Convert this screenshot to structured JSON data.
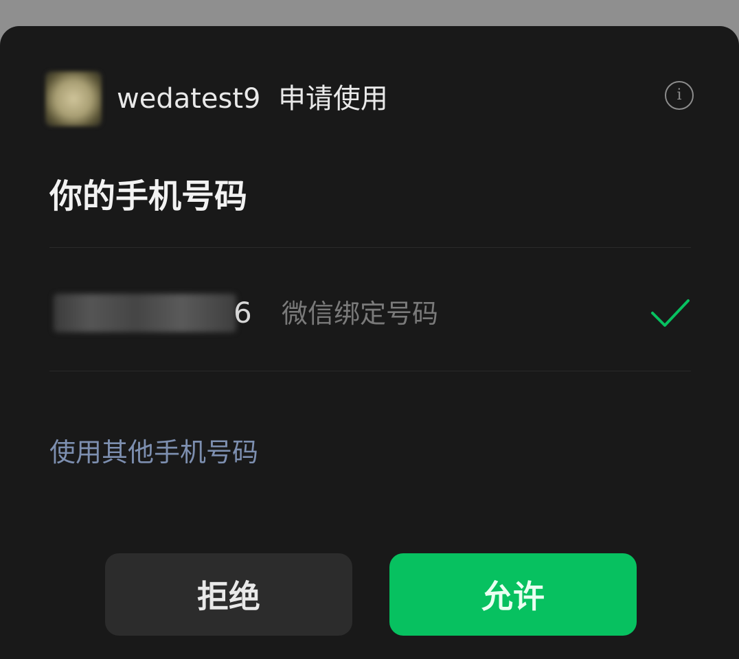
{
  "header": {
    "app_name": "wedatest9",
    "request_text": "申请使用",
    "info_icon": "info-circle-icon"
  },
  "section": {
    "title": "你的手机号码"
  },
  "phone": {
    "number_visible_tail": "6",
    "description": "微信绑定号码",
    "selected": true,
    "check_icon": "check-icon"
  },
  "links": {
    "use_other_number": "使用其他手机号码"
  },
  "buttons": {
    "reject_label": "拒绝",
    "allow_label": "允许"
  },
  "colors": {
    "background": "#191919",
    "accent_green": "#07c160",
    "link_blue": "#7d8fb0",
    "check_green": "#07c160"
  }
}
